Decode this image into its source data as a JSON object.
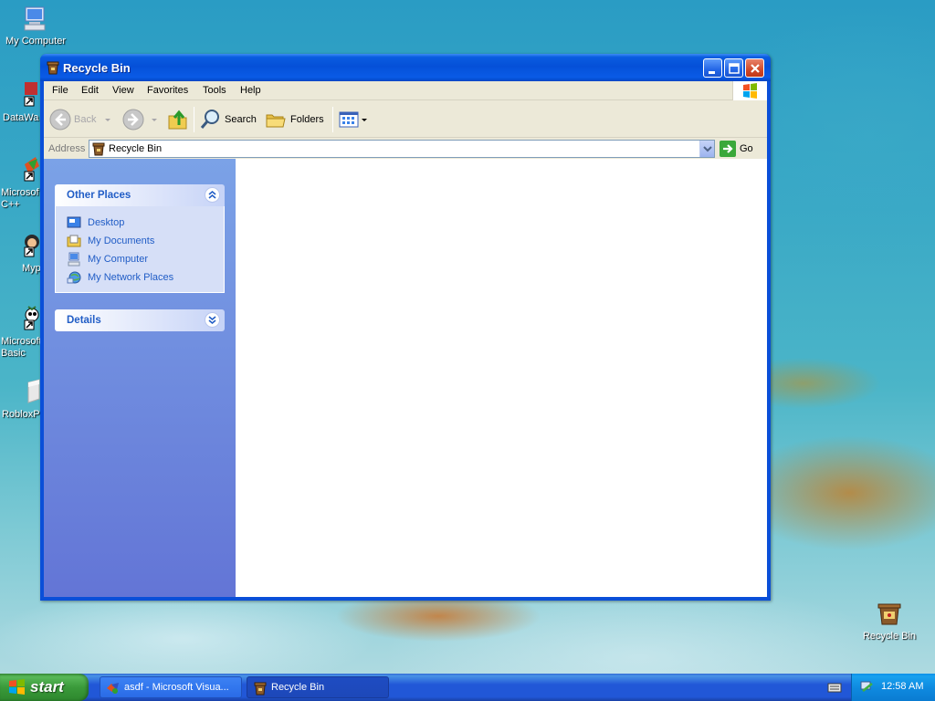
{
  "desktop": {
    "icons": [
      {
        "label": "My Computer"
      },
      {
        "label": "DataWa"
      },
      {
        "label": "Microsof\nC++"
      },
      {
        "label": "Myp"
      },
      {
        "label": "Microsoft\nBasic"
      },
      {
        "label": "RobloxPl"
      },
      {
        "label": "Recycle Bin"
      }
    ]
  },
  "window": {
    "title": "Recycle Bin",
    "menu": [
      "File",
      "Edit",
      "View",
      "Favorites",
      "Tools",
      "Help"
    ],
    "toolbar": {
      "back_label": "Back",
      "search_label": "Search",
      "folders_label": "Folders"
    },
    "address": {
      "label": "Address",
      "value": "Recycle Bin",
      "go_label": "Go"
    },
    "taskpane": {
      "other_places": {
        "title": "Other Places",
        "links": [
          "Desktop",
          "My Documents",
          "My Computer",
          "My Network Places"
        ]
      },
      "details": {
        "title": "Details"
      }
    }
  },
  "taskbar": {
    "start_label": "start",
    "tasks": [
      {
        "label": "asdf - Microsoft Visua..."
      },
      {
        "label": "Recycle Bin"
      }
    ],
    "clock": "12:58 AM"
  },
  "colors": {
    "xp_blue": "#0a5ce0",
    "task_link": "#215dc6",
    "start_green": "#3a9a3a"
  }
}
